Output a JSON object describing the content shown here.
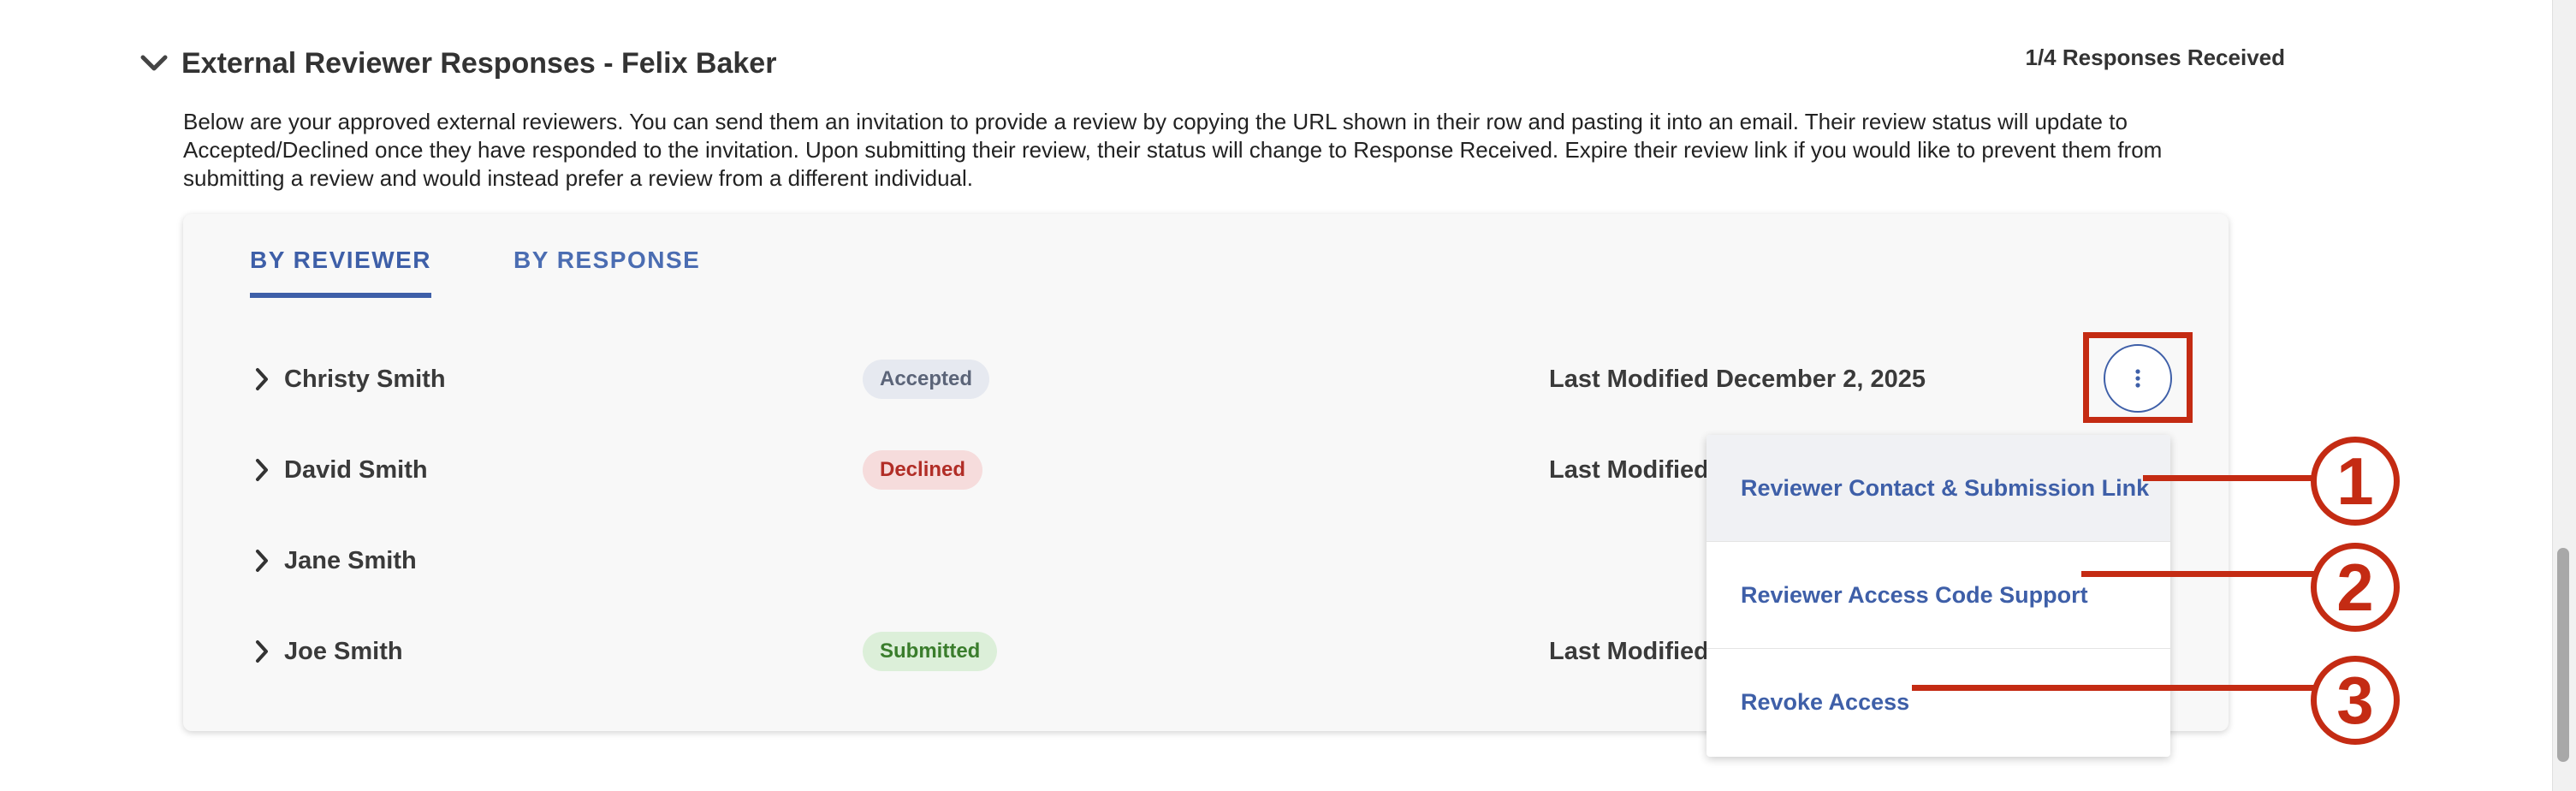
{
  "section": {
    "title": "External Reviewer Responses - Felix Baker",
    "responses_count": "1/4 Responses Received",
    "description": "Below are your approved external reviewers. You can send them an invitation to provide a review by copying the URL shown in their row and pasting it into an email. Their review status will update to Accepted/Declined once they have responded to the invitation. Upon submitting their review, their status will change to Response Received. Expire their review link if you would like to prevent them from submitting a review and would instead prefer a review from a different individual."
  },
  "tabs": [
    {
      "label": "BY REVIEWER",
      "active": true
    },
    {
      "label": "BY RESPONSE",
      "active": false
    }
  ],
  "reviewers": [
    {
      "name": "Christy Smith",
      "status": "Accepted",
      "modified": "Last Modified December 2, 2025"
    },
    {
      "name": "David Smith",
      "status": "Declined",
      "modified": "Last Modified Dece"
    },
    {
      "name": "Jane Smith",
      "status": "",
      "modified": ""
    },
    {
      "name": "Joe Smith",
      "status": "Submitted",
      "modified": "Last Modified Dece"
    }
  ],
  "menu": {
    "items": [
      "Reviewer Contact & Submission Link",
      "Reviewer Access Code Support",
      "Revoke Access"
    ]
  },
  "annotations": [
    "1",
    "2",
    "3"
  ],
  "colors": {
    "accent": "#3e5fa8",
    "annotation": "#c42b13",
    "declined": "#b12d26",
    "submitted": "#3a7d2c"
  },
  "icons": {
    "collapse": "chevron-down-icon",
    "expand": "chevron-right-icon",
    "more": "kebab-menu-icon"
  }
}
